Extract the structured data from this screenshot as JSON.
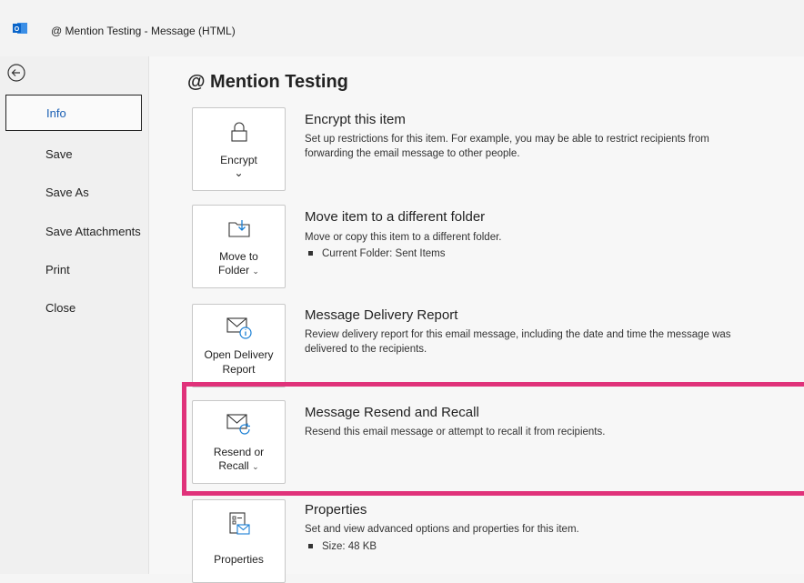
{
  "window": {
    "title": "@ Mention Testing  -  Message (HTML)"
  },
  "sidebar": {
    "items": [
      {
        "label": "Info"
      },
      {
        "label": "Save"
      },
      {
        "label": "Save As"
      },
      {
        "label": "Save Attachments"
      },
      {
        "label": "Print"
      },
      {
        "label": "Close"
      }
    ]
  },
  "main": {
    "title": "@ Mention Testing",
    "sections": [
      {
        "button": "Encrypt",
        "title": "Encrypt this item",
        "desc": "Set up restrictions for this item. For example, you may be able to restrict recipients from forwarding the email message to other people."
      },
      {
        "button_l1": "Move to",
        "button_l2": "Folder",
        "title": "Move item to a different folder",
        "desc": "Move or copy this item to a different folder.",
        "detail": "Current Folder:  Sent Items"
      },
      {
        "button_l1": "Open Delivery",
        "button_l2": "Report",
        "title": "Message Delivery Report",
        "desc": "Review delivery report for this email message, including the date and time the message was delivered to the recipients."
      },
      {
        "button_l1": "Resend or",
        "button_l2": "Recall",
        "title": "Message Resend and Recall",
        "desc": "Resend this email message or attempt to recall it from recipients."
      },
      {
        "button": "Properties",
        "title": "Properties",
        "desc": "Set and view advanced options and properties for this item.",
        "detail": "Size:  48 KB"
      }
    ]
  },
  "colors": {
    "highlight": "#e0327a",
    "accent": "#1a5fb4"
  }
}
